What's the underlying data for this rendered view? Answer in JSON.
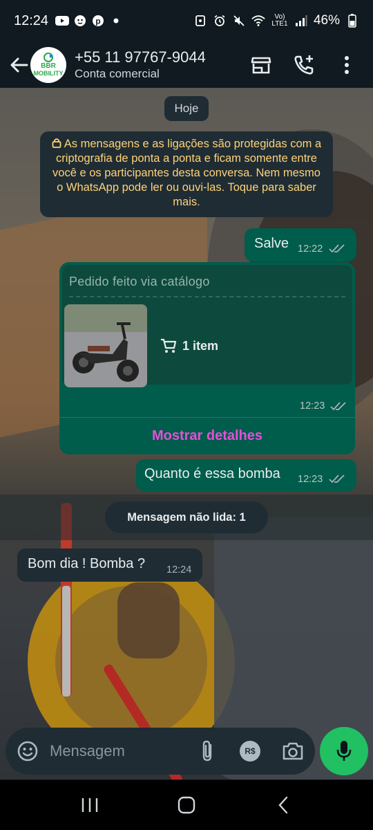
{
  "status_bar": {
    "time": "12:24",
    "network_label": "Vo) LTE1",
    "battery": "46%",
    "icons": [
      "youtube-icon",
      "baby-monitor-icon",
      "pinterest-icon",
      "notification-dot-icon",
      "cast-icon",
      "alarm-icon",
      "mute-icon",
      "wifi-icon",
      "signal-icon",
      "battery-icon"
    ]
  },
  "header": {
    "contact_name": "+55 11 97767-9044",
    "subtitle": "Conta comercial",
    "avatar_text_1": "BBR",
    "avatar_text_2": "MOBILITY",
    "actions": [
      "store-icon",
      "add-call-icon",
      "more-options-icon"
    ]
  },
  "chat": {
    "date_chip": "Hoje",
    "encryption_notice": "As mensagens e as ligações são protegidas com a criptografia de ponta a ponta e ficam somente entre você e os participantes desta conversa. Nem mesmo o WhatsApp pode ler ou ouvi-las. Toque para saber mais.",
    "messages": [
      {
        "direction": "out",
        "text": "Salve",
        "time": "12:22",
        "status": "read"
      },
      {
        "direction": "out",
        "type": "order",
        "time": "12:23",
        "status": "read"
      },
      {
        "direction": "out",
        "text": "Quanto é essa bomba",
        "time": "12:23",
        "status": "read"
      },
      {
        "direction": "in",
        "text": "Bom dia ! Bomba ?",
        "time": "12:24"
      }
    ],
    "order": {
      "title": "Pedido feito via catálogo",
      "items_label": "1 item",
      "details_button": "Mostrar detalhes"
    },
    "unread_label": "Mensagem não lida: 1"
  },
  "input": {
    "placeholder": "Mensagem",
    "icons": [
      "emoji-icon",
      "attach-icon",
      "payment-icon",
      "camera-icon",
      "mic-icon"
    ],
    "payment_label": "R$"
  },
  "nav": {
    "buttons": [
      "recent-apps-icon",
      "home-icon",
      "back-icon"
    ]
  },
  "colors": {
    "header_bg": "#101a20",
    "outgoing_bubble": "#005c4b",
    "incoming_bubble": "#1f2c34",
    "accent_green": "#21c063",
    "details_link": "#e64fd9",
    "notice_text": "#ffd279"
  }
}
